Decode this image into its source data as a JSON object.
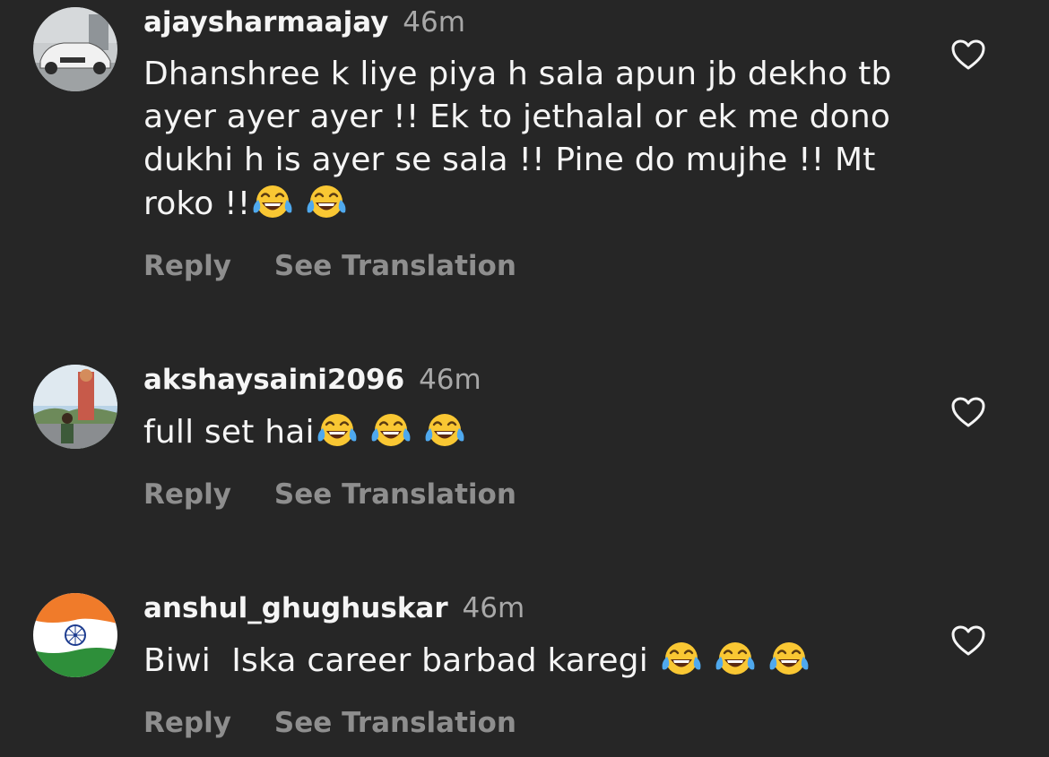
{
  "comments": [
    {
      "username": "ajaysharmaajay",
      "time": "46m",
      "text": "Dhanshree k liye piya h sala apun jb dekho tb ayer ayer ayer !! Ek to jethalal or ek me dono dukhi h is ayer se sala !! Pine do mujhe !! Mt roko !!",
      "emoji": [
        "face-with-tears-of-joy",
        "face-with-tears-of-joy"
      ],
      "avatar": "car-photo",
      "reply_label": "Reply",
      "translate_label": "See Translation"
    },
    {
      "username": "akshaysaini2096",
      "time": "46m",
      "text": "full set hai",
      "emoji": [
        "face-with-tears-of-joy",
        "face-with-tears-of-joy",
        "face-with-tears-of-joy"
      ],
      "avatar": "statue-photo",
      "reply_label": "Reply",
      "translate_label": "See Translation"
    },
    {
      "username": "anshul_ghughuskar",
      "time": "46m",
      "text": "Biwi  Iska career barbad karegi ",
      "emoji": [
        "face-with-tears-of-joy",
        "face-with-tears-of-joy",
        "face-with-tears-of-joy"
      ],
      "avatar": "india-flag",
      "reply_label": "Reply",
      "translate_label": "See Translation"
    }
  ],
  "like_icon": "heart-outline-icon",
  "colors": {
    "background": "#262626",
    "text": "#f5f5f5",
    "secondary": "#a8a8a8",
    "action": "#8e8e8e"
  }
}
